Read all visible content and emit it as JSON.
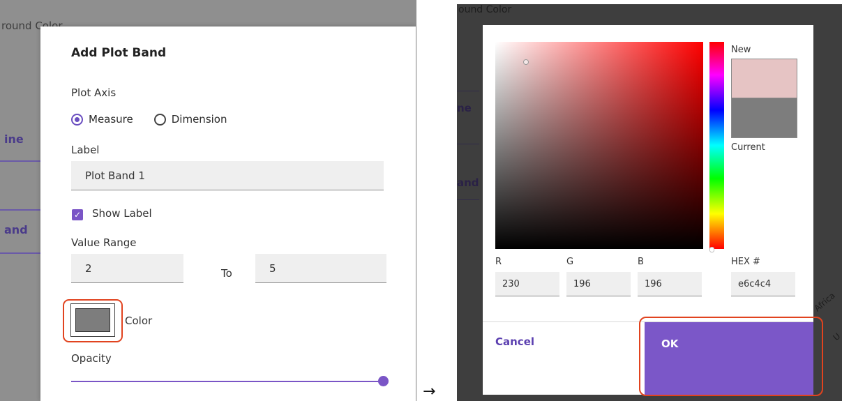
{
  "background": {
    "left_partial_heading": "round Color",
    "left_tab1": "ine",
    "left_tab2": "and",
    "right_partial_heading": "ound Color",
    "right_tab1": "ne",
    "right_tab2": "and",
    "right_axis_label1": "Africa",
    "right_axis_label2": "U"
  },
  "plot_band_dialog": {
    "title": "Add Plot Band",
    "plot_axis_label": "Plot Axis",
    "radio_measure": "Measure",
    "radio_dimension": "Dimension",
    "selected_axis": "Measure",
    "label_label": "Label",
    "label_value": "Plot Band 1",
    "show_label": "Show Label",
    "show_label_checked": true,
    "value_range_label": "Value Range",
    "range_from": "2",
    "range_to_label": "To",
    "range_to": "5",
    "color_label": "Color",
    "color_value": "#7d7d7d",
    "opacity_label": "Opacity",
    "opacity_fraction": 1.0
  },
  "arrow": "→",
  "color_picker": {
    "new_label": "New",
    "current_label": "Current",
    "new_color": "#e6c4c4",
    "current_color": "#7d7d7d",
    "r_label": "R",
    "g_label": "G",
    "b_label": "B",
    "hex_label": "HEX #",
    "r_value": "230",
    "g_value": "196",
    "b_value": "196",
    "hex_value": "e6c4c4",
    "cancel_label": "Cancel",
    "ok_label": "OK"
  },
  "colors": {
    "accent": "#7b57c8",
    "highlight": "#e1431f"
  }
}
